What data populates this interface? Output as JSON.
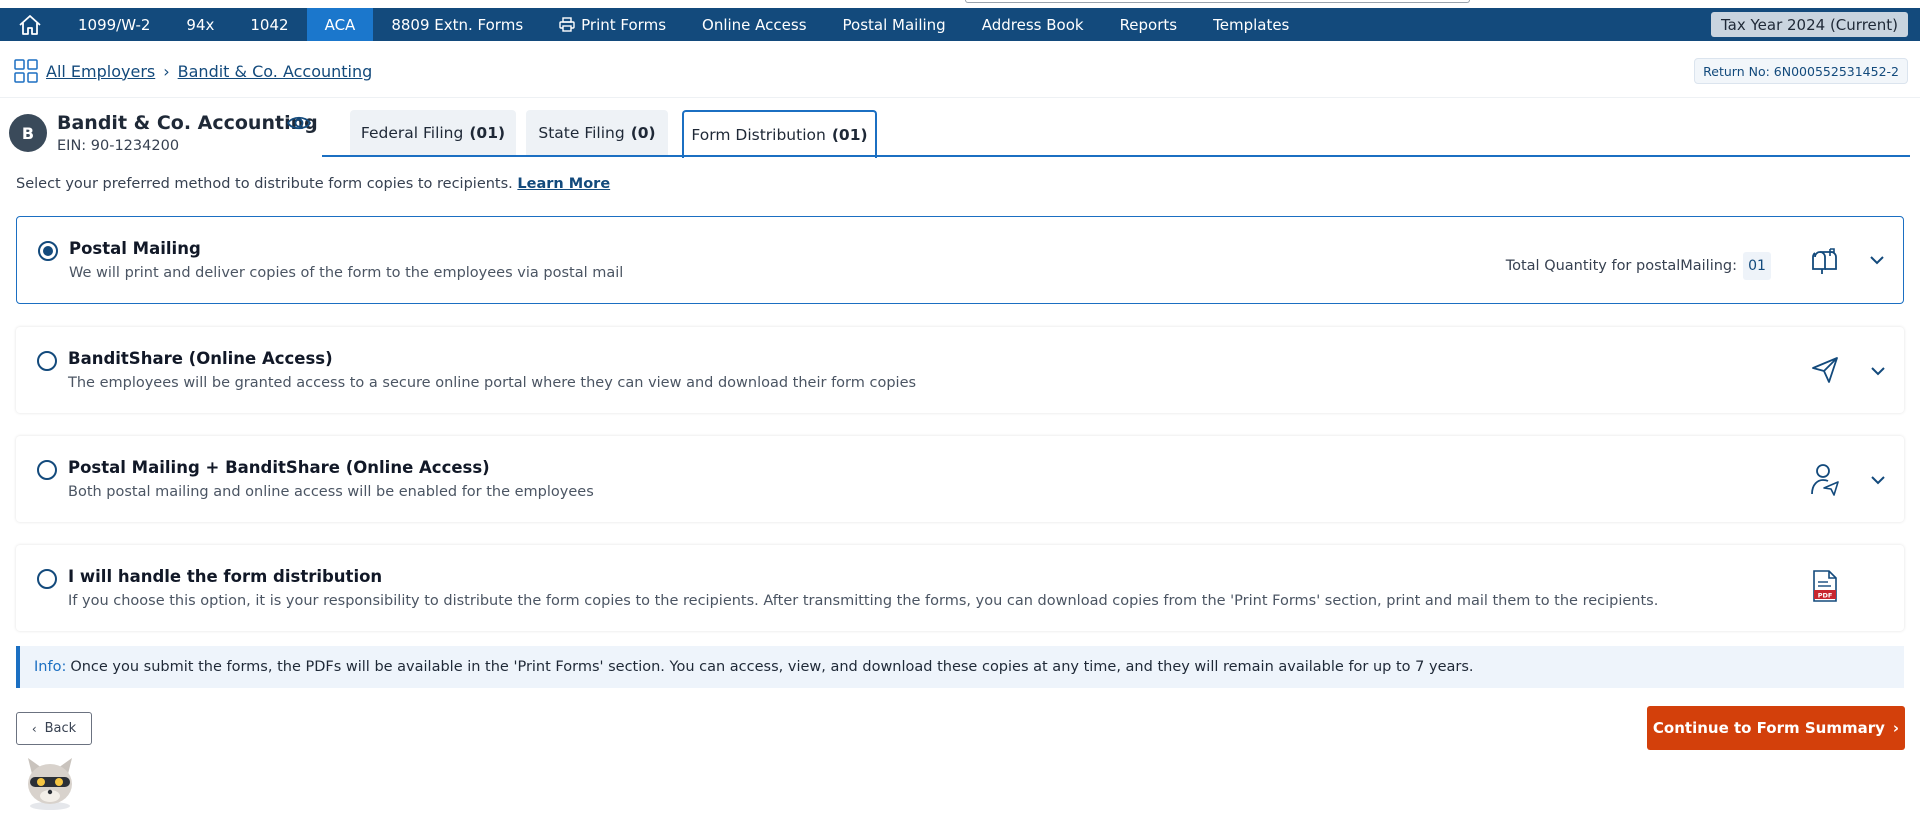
{
  "nav": {
    "items": [
      {
        "label": "1099/W-2",
        "active": false
      },
      {
        "label": "94x",
        "active": false
      },
      {
        "label": "1042",
        "active": false
      },
      {
        "label": "ACA",
        "active": true
      },
      {
        "label": "8809 Extn. Forms",
        "active": false
      },
      {
        "label": "Print Forms",
        "active": false,
        "icon": "printer-icon"
      },
      {
        "label": "Online Access",
        "active": false
      },
      {
        "label": "Postal Mailing",
        "active": false
      },
      {
        "label": "Address Book",
        "active": false
      },
      {
        "label": "Reports",
        "active": false
      },
      {
        "label": "Templates",
        "active": false
      }
    ],
    "tax_year": "Tax Year 2024 (Current)"
  },
  "breadcrumb": {
    "all_employers": "All Employers",
    "employer": "Bandit & Co. Accounting",
    "return_no": "Return No: 6N000552531452-2"
  },
  "employer": {
    "initial": "B",
    "name": "Bandit & Co. Accounting",
    "ein": "EIN: 90-1234200"
  },
  "tabs": [
    {
      "label": "Federal Filing",
      "count": "(01)",
      "active": false
    },
    {
      "label": "State Filing",
      "count": "(0)",
      "active": false
    },
    {
      "label": "Form Distribution",
      "count": "(01)",
      "active": true
    }
  ],
  "intro": {
    "text": "Select your preferred method to distribute form copies to recipients.",
    "link": "Learn More"
  },
  "options": [
    {
      "title": "Postal Mailing",
      "desc": "We will print and deliver copies of the form to the employees via postal mail",
      "selected": true,
      "qty_label": "Total Quantity for postalMailing:",
      "qty": "01",
      "icon": "mailbox-icon"
    },
    {
      "title": "BanditShare (Online Access)",
      "desc": "The employees will be granted access to a secure online portal where they can view and download their form copies",
      "selected": false,
      "icon": "send-icon"
    },
    {
      "title": "Postal Mailing + BanditShare (Online Access)",
      "desc": "Both postal mailing and online access will be enabled for the employees",
      "selected": false,
      "icon": "user-send-icon"
    },
    {
      "title": "I will handle the form distribution",
      "desc": "If you choose this option, it is your responsibility to distribute the form copies to the recipients. After transmitting the forms, you can download copies from the 'Print Forms' section, print and mail them to the recipients.",
      "selected": false,
      "icon": "pdf-icon"
    }
  ],
  "info": {
    "label": "Info:",
    "text": "Once you submit the forms, the PDFs will be available in the 'Print Forms' section. You can access, view, and download these copies at any time, and they will remain available for up to 7 years."
  },
  "buttons": {
    "back": "Back",
    "continue": "Continue to Form Summary"
  },
  "colors": {
    "nav_bg": "#134a7c",
    "nav_active": "#1b77cc",
    "accent": "#1b6fc2",
    "primary_button": "#d3400b"
  }
}
